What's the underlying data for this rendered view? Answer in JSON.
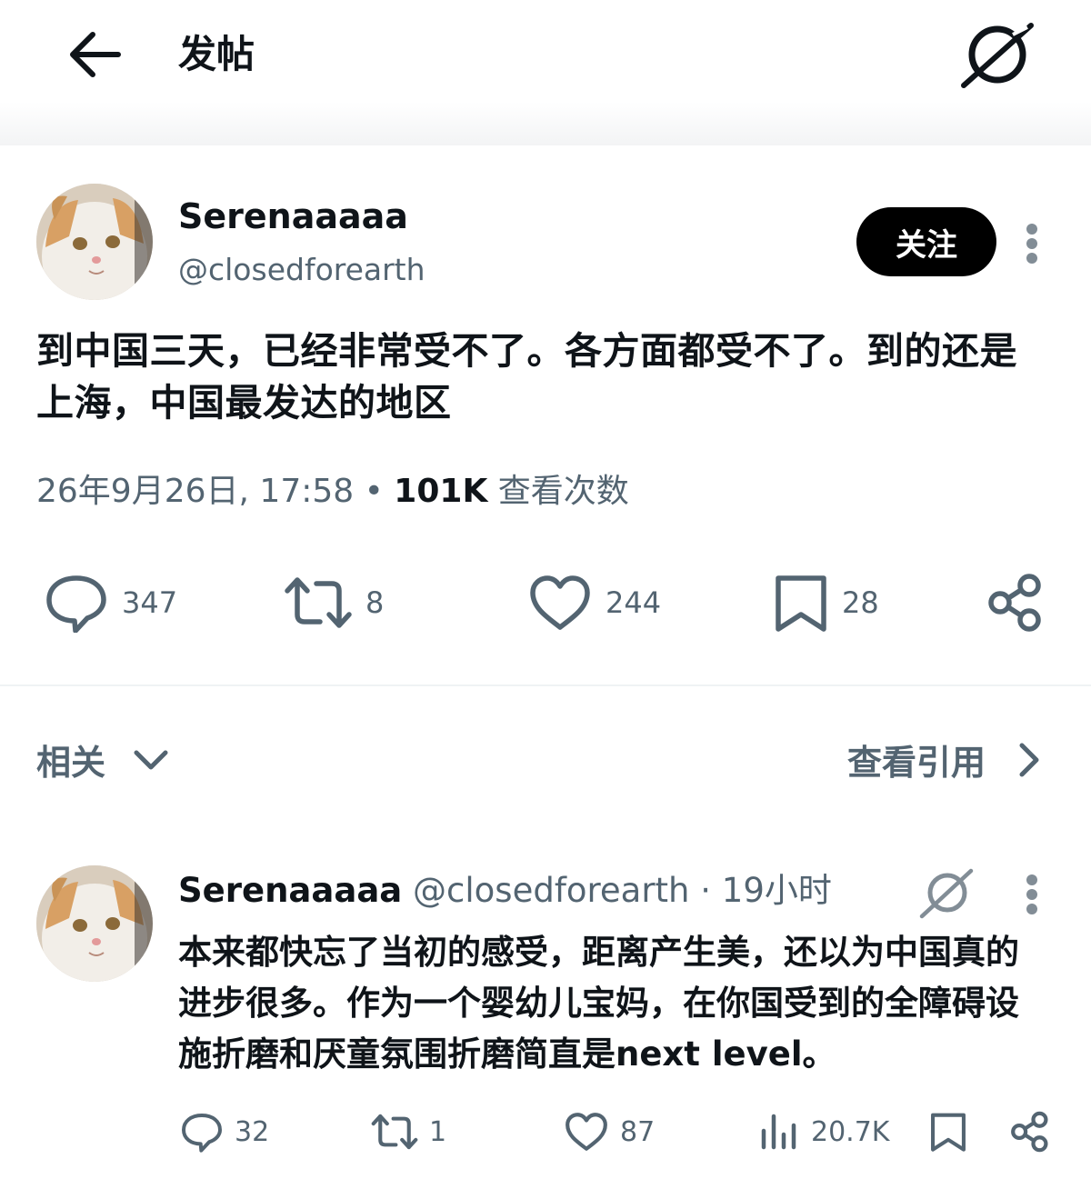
{
  "header": {
    "title": "发帖"
  },
  "post": {
    "author_name": "Serenaaaaa",
    "author_handle": "@closedforearth",
    "follow_label": "关注",
    "text": "到中国三天，已经非常受不了。各方面都受不了。到的还是上海，中国最发达的地区",
    "timestamp": "26年9月26日, 17:58",
    "separator": "•",
    "views_count": "101K",
    "views_label": "查看次数",
    "replies": "347",
    "reposts": "8",
    "likes": "244",
    "bookmarks": "28"
  },
  "related": {
    "label": "相关",
    "view_quotes_label": "查看引用"
  },
  "reply": {
    "author_name": "Serenaaaaa",
    "author_handle": "@closedforearth",
    "dot": "·",
    "time": "19小时",
    "text": "本来都快忘了当初的感受，距离产生美，还以为中国真的进步很多。作为一个婴幼儿宝妈，在你国受到的全障碍设施折磨和厌童氛围折磨简直是next level。",
    "replies": "32",
    "reposts": "1",
    "likes": "87",
    "views": "20.7K"
  },
  "icons": {
    "back": "arrow-left-icon",
    "grok": "grok-icon",
    "more": "more-vertical-icon",
    "reply": "comment-icon",
    "repost": "repost-icon",
    "like": "heart-icon",
    "bookmark": "bookmark-icon",
    "share": "share-icon",
    "views": "analytics-icon",
    "chevron_down": "chevron-down-icon",
    "chevron_right": "chevron-right-icon"
  },
  "colors": {
    "text_primary": "#0f1419",
    "text_secondary": "#536471",
    "follow_button_bg": "#000000"
  }
}
